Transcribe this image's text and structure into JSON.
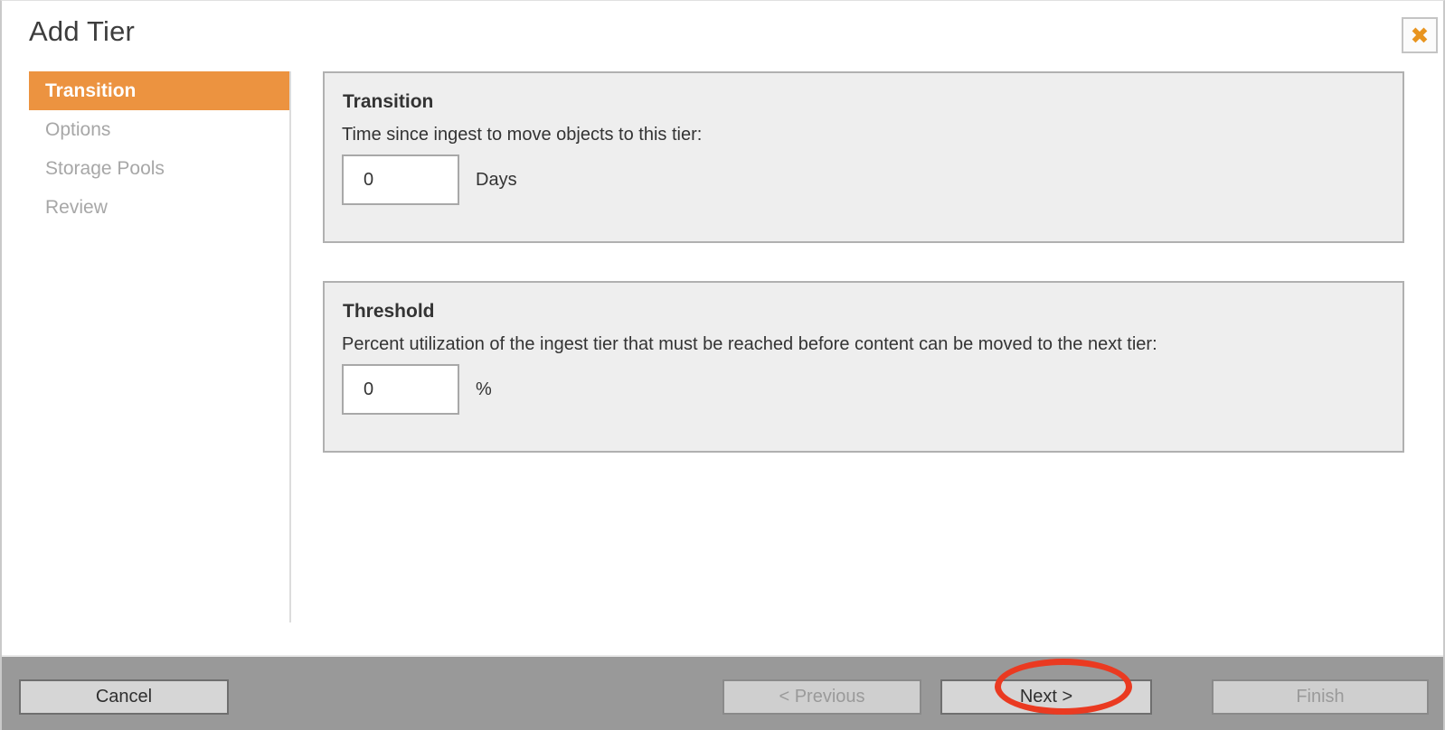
{
  "dialog": {
    "title": "Add Tier",
    "close_icon": "close-x-icon",
    "close_glyph": "✖"
  },
  "sidebar": {
    "items": [
      {
        "label": "Transition",
        "active": true
      },
      {
        "label": "Options",
        "active": false
      },
      {
        "label": "Storage Pools",
        "active": false
      },
      {
        "label": "Review",
        "active": false
      }
    ]
  },
  "panels": {
    "transition": {
      "heading": "Transition",
      "description": "Time since ingest to move objects to this tier:",
      "value": "0",
      "placeholder": "",
      "unit": "Days"
    },
    "threshold": {
      "heading": "Threshold",
      "description": "Percent utilization of the ingest tier that must be reached before content can be moved to the next tier:",
      "value": "0",
      "placeholder": "",
      "unit": "%"
    }
  },
  "footer": {
    "cancel_label": "Cancel",
    "previous_label": "< Previous",
    "next_label": "Next >",
    "finish_label": "Finish"
  },
  "annotation": {
    "target": "Next >",
    "shape": "ellipse",
    "color": "#ea3a21"
  },
  "colors": {
    "accent_orange": "#ec9340",
    "footer_gray": "#999999",
    "panel_gray": "#eeeeee",
    "annotation_red": "#ea3a21"
  }
}
